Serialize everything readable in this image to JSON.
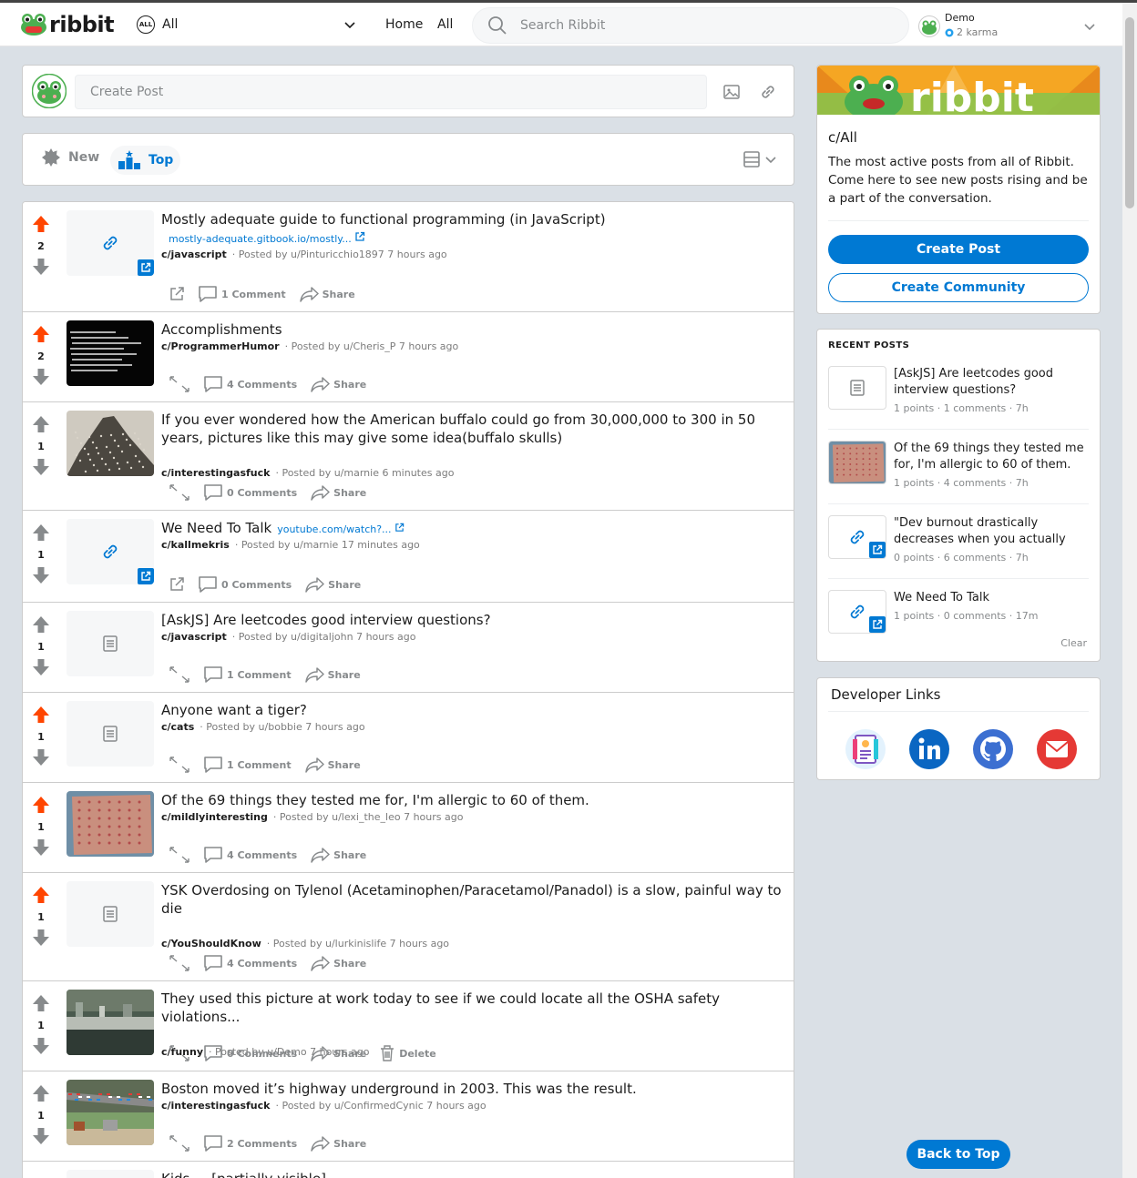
{
  "header": {
    "logo_text": "ribbit",
    "community": {
      "badge": "ALL",
      "label": "All"
    },
    "nav_home": "Home",
    "nav_all": "All",
    "search_placeholder": "Search Ribbit",
    "user": {
      "name": "Demo",
      "karma": "2 karma"
    }
  },
  "create_post": {
    "placeholder": "Create Post",
    "icons": [
      "image-icon",
      "link-icon"
    ]
  },
  "sort": {
    "new": "New",
    "top": "Top",
    "active": "Top"
  },
  "posts": [
    {
      "title": "Mostly adequate guide to functional programming (in JavaScript)",
      "link": "mostly-adequate.gitbook.io/mostly...",
      "link_inline": false,
      "community": "c/javascript",
      "meta": "Posted by u/Pinturicchio1897 7 hours ago",
      "score": "2",
      "upvoted": true,
      "thumb": "link",
      "comments": "1 Comment",
      "share": "Share",
      "first_action": "external"
    },
    {
      "title": "Accomplishments",
      "community": "c/ProgrammerHumor",
      "meta": "Posted by u/Cheris_P 7 hours ago",
      "score": "2",
      "upvoted": true,
      "thumb": "dark-image",
      "comments": "4 Comments",
      "share": "Share",
      "first_action": "expand"
    },
    {
      "title": "If you ever wondered how the American buffalo could go from 30,000,000 to 300 in 50 years, pictures like this may give some idea(buffalo skulls)",
      "community": "c/interestingasfuck",
      "meta": "Posted by u/marnie 6 minutes ago",
      "score": "1",
      "upvoted": false,
      "thumb": "skulls-image",
      "comments": "0 Comments",
      "share": "Share",
      "first_action": "expand"
    },
    {
      "title": "We Need To Talk",
      "link": "youtube.com/watch?...",
      "link_inline": true,
      "community": "c/kallmekris",
      "meta": "Posted by u/marnie 17 minutes ago",
      "score": "1",
      "upvoted": false,
      "thumb": "link",
      "comments": "0 Comments",
      "share": "Share",
      "first_action": "external"
    },
    {
      "title": "[AskJS] Are leetcodes good interview questions?",
      "community": "c/javascript",
      "meta": "Posted by u/digitaljohn 7 hours ago",
      "score": "1",
      "upvoted": false,
      "thumb": "text",
      "comments": "1 Comment",
      "share": "Share",
      "first_action": "expand"
    },
    {
      "title": "Anyone want a tiger?",
      "community": "c/cats",
      "meta": "Posted by u/bobbie 7 hours ago",
      "score": "1",
      "upvoted": true,
      "thumb": "text",
      "comments": "1 Comment",
      "share": "Share",
      "first_action": "expand"
    },
    {
      "title": "Of the 69 things they tested me for, I'm allergic to 60 of them.",
      "community": "c/mildlyinteresting",
      "meta": "Posted by u/lexi_the_leo 7 hours ago",
      "score": "1",
      "upvoted": true,
      "thumb": "skin-image",
      "comments": "4 Comments",
      "share": "Share",
      "first_action": "expand"
    },
    {
      "title": "YSK Overdosing on Tylenol (Acetaminophen/Paracetamol/Panadol) is a slow, painful way to die",
      "community": "c/YouShouldKnow",
      "meta": "Posted by u/lurkinislife 7 hours ago",
      "score": "1",
      "upvoted": true,
      "thumb": "text",
      "comments": "4 Comments",
      "share": "Share",
      "first_action": "expand"
    },
    {
      "title": "They used this picture at work today to see if we could locate all the OSHA safety violations...",
      "community": "c/funny",
      "meta": "Posted by u/Demo 7 hours ago",
      "score": "1",
      "upvoted": false,
      "thumb": "kitchen-image",
      "comments": "0 Comments",
      "share": "Share",
      "delete": "Delete",
      "first_action": "expand"
    },
    {
      "title": "Boston moved it’s highway underground in 2003. This was the result.",
      "community": "c/interestingasfuck",
      "meta": "Posted by u/ConfirmedCynic 7 hours ago",
      "score": "1",
      "upvoted": false,
      "thumb": "highway-image",
      "comments": "2 Comments",
      "share": "Share",
      "first_action": "expand"
    },
    {
      "title": "Kids ... [partially visible]",
      "community": "",
      "meta": "",
      "score": "",
      "upvoted": false,
      "thumb": "text",
      "comments": "",
      "share": "",
      "first_action": "expand"
    }
  ],
  "sidebar": {
    "about": {
      "banner_text": "ribbit",
      "title": "c/All",
      "description": "The most active posts from all of Ribbit. Come here to see new posts rising and be a part of the conversation.",
      "create_post": "Create Post",
      "create_community": "Create Community"
    },
    "recent": {
      "header": "RECENT POSTS",
      "items": [
        {
          "title": "[AskJS] Are leetcodes good interview questions?",
          "meta": "1 points · 1 comments · 7h",
          "thumb": "text"
        },
        {
          "title": "Of the 69 things they tested me for, I'm allergic to 60 of them.",
          "meta": "1 points · 4 comments · 7h",
          "thumb": "skin-image"
        },
        {
          "title": "\"Dev burnout drastically decreases when you actually",
          "meta": "0 points · 6 comments · 7h",
          "thumb": "link"
        },
        {
          "title": "We Need To Talk",
          "meta": "1 points · 0 comments · 17m",
          "thumb": "link"
        }
      ],
      "clear": "Clear"
    },
    "dev_links": {
      "title": "Developer Links",
      "icons": [
        "portfolio-icon",
        "linkedin-icon",
        "github-icon",
        "email-icon"
      ]
    }
  },
  "back_to_top": "Back to Top",
  "colors": {
    "accent": "#0079d3",
    "upvote": "#ff4500",
    "vote_neutral": "#878a8c",
    "background": "#dae0e6"
  }
}
